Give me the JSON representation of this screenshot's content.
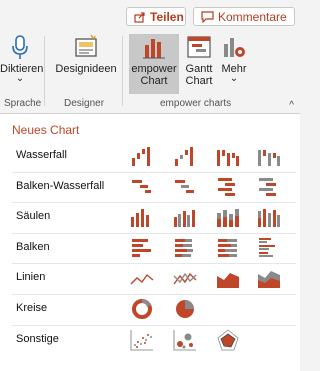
{
  "topbar": {
    "share_label": "Teilen",
    "comment_label": "Kommentare"
  },
  "ribbon": {
    "dictate": {
      "label": "Diktieren",
      "caret": "⌄"
    },
    "designer": {
      "label": "Designideen"
    },
    "empower_chart": {
      "label": "empower Chart"
    },
    "gantt_chart": {
      "label": "Gantt Chart"
    },
    "more": {
      "label": "Mehr",
      "caret": "⌄"
    },
    "groups": {
      "speech": "Sprache",
      "designer": "Designer",
      "empower": "empower charts"
    },
    "collapse_caret": "^"
  },
  "panel": {
    "title": "Neues Chart",
    "rows": [
      {
        "label": "Wasserfall",
        "icons": [
          "waterfall-chart-icon",
          "waterfall-chart-icon",
          "waterfall-chart-icon",
          "waterfall-chart-icon"
        ]
      },
      {
        "label": "Balken-Wasserfall",
        "icons": [
          "bar-waterfall-chart-icon",
          "bar-waterfall-chart-icon",
          "bar-waterfall-chart-icon",
          "bar-waterfall-chart-icon"
        ]
      },
      {
        "label": "Säulen",
        "icons": [
          "column-chart-icon",
          "column-chart-icon",
          "column-chart-icon",
          "column-chart-icon"
        ]
      },
      {
        "label": "Balken",
        "icons": [
          "bar-chart-icon",
          "bar-chart-icon",
          "bar-chart-icon",
          "bar-chart-icon"
        ]
      },
      {
        "label": "Linien",
        "icons": [
          "line-chart-icon",
          "line-chart-icon",
          "area-chart-icon",
          "area-chart-icon"
        ]
      },
      {
        "label": "Kreise",
        "icons": [
          "donut-chart-icon",
          "pie-chart-icon"
        ]
      },
      {
        "label": "Sonstige",
        "icons": [
          "scatter-chart-icon",
          "bubble-chart-icon",
          "radar-chart-icon"
        ]
      }
    ]
  },
  "colors": {
    "accent": "#c0462a",
    "gray": "#8a8a8a",
    "blue": "#2b6cb3"
  }
}
